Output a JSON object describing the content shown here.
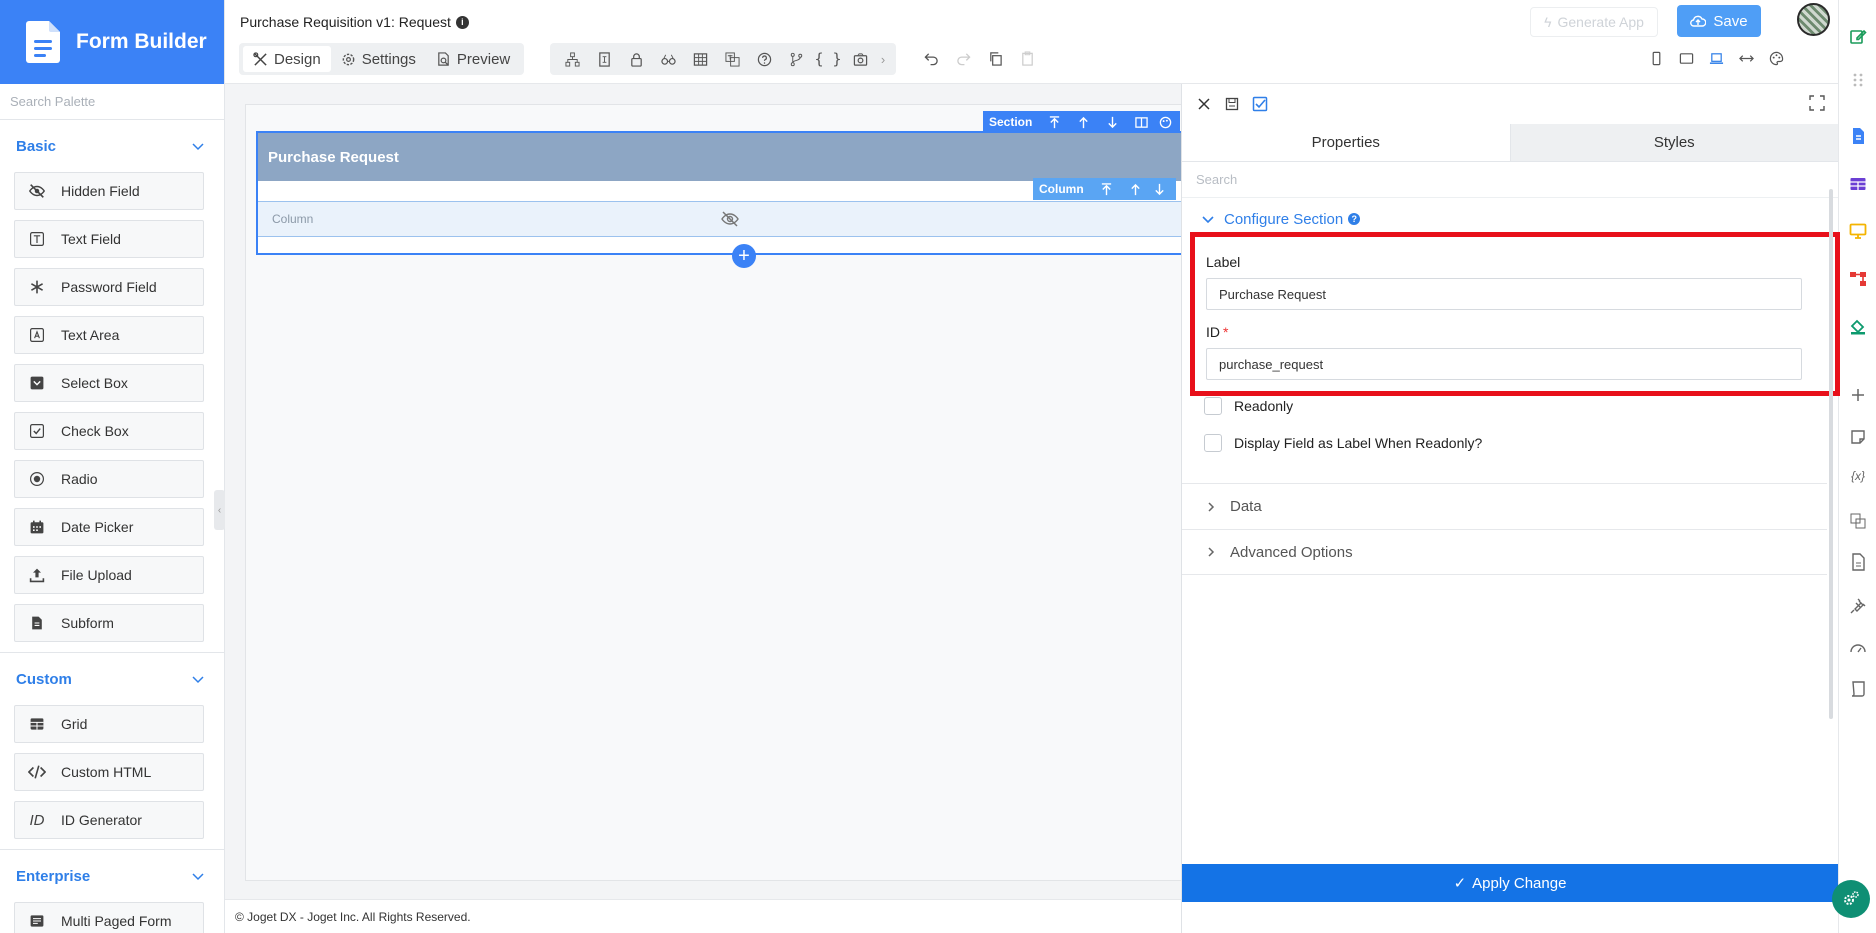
{
  "app": {
    "title": "Form Builder"
  },
  "palette": {
    "search_placeholder": "Search Palette",
    "groups": [
      {
        "name": "Basic",
        "items": [
          "Hidden Field",
          "Text Field",
          "Password Field",
          "Text Area",
          "Select Box",
          "Check Box",
          "Radio",
          "Date Picker",
          "File Upload",
          "Subform"
        ]
      },
      {
        "name": "Custom",
        "items": [
          "Grid",
          "Custom HTML",
          "ID Generator"
        ]
      },
      {
        "name": "Enterprise",
        "items": [
          "Multi Paged Form"
        ]
      }
    ]
  },
  "header": {
    "form_title": "Purchase Requisition v1: Request",
    "tabs": {
      "design": "Design",
      "settings": "Settings",
      "preview": "Preview"
    },
    "generate_app": "Generate App",
    "save": "Save"
  },
  "canvas": {
    "section_label": "Purchase Request",
    "section_toolbar_label": "Section",
    "column_label": "Column",
    "column_toolbar_label": "Column"
  },
  "footer": {
    "copyright": "© Joget DX - Joget Inc. All Rights Reserved."
  },
  "properties": {
    "tabs": {
      "properties": "Properties",
      "styles": "Styles"
    },
    "search_placeholder": "Search",
    "configure_section": "Configure Section",
    "label_field": {
      "label": "Label",
      "value": "Purchase Request"
    },
    "id_field": {
      "label": "ID",
      "required_mark": "*",
      "value": "purchase_request"
    },
    "readonly": "Readonly",
    "display_as_label": "Display Field as Label When Readonly?",
    "data": "Data",
    "advanced_options": "Advanced Options",
    "apply_change": "Apply Change"
  },
  "colors": {
    "primary": "#3b82f6",
    "highlight": "#e8101a",
    "apply": "#1473e6"
  }
}
